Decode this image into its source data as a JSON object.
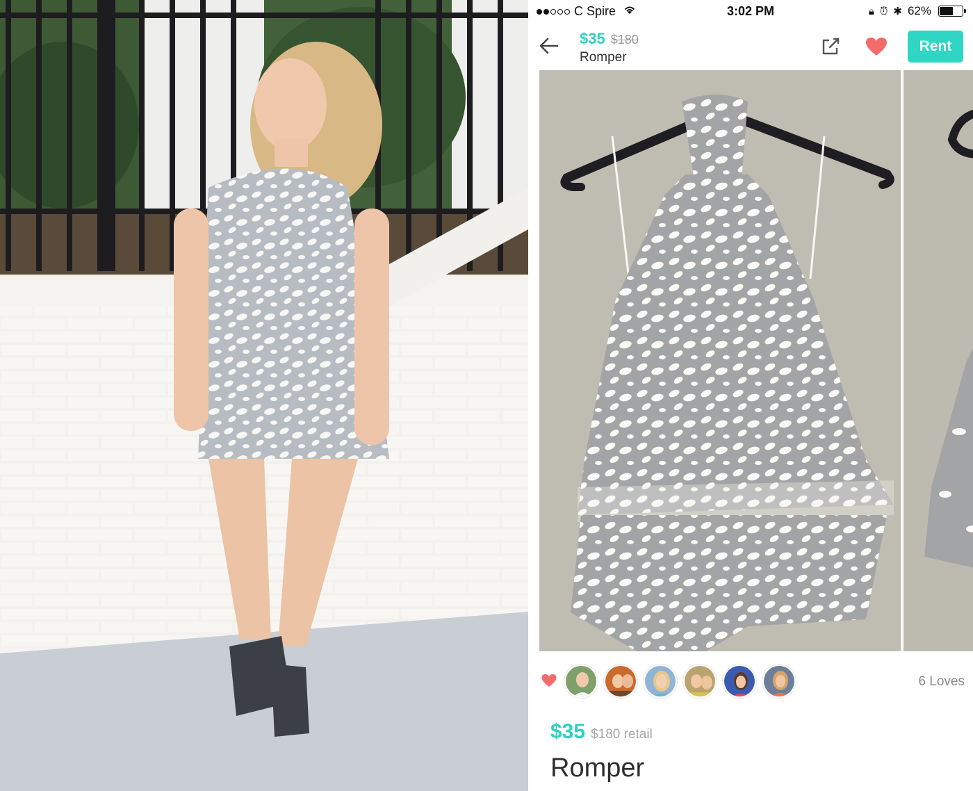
{
  "status_bar": {
    "signal_bars_filled": 2,
    "signal_bars_total": 5,
    "carrier": "C Spire",
    "time": "3:02 PM",
    "battery_percent_text": "62%",
    "battery_level": 0.62,
    "icons": [
      "wifi-icon",
      "orientation-lock-icon",
      "alarm-icon",
      "bluetooth-icon",
      "battery-icon"
    ]
  },
  "nav": {
    "price": "$35",
    "retail": "$180",
    "title": "Romper",
    "back_icon": "arrow-left-icon",
    "share_icon": "external-share-icon",
    "heart_icon": "heart-icon",
    "rent_label": "Rent"
  },
  "gallery": {
    "images": [
      "romper-on-hanger-photo",
      "romper-second-photo-partial"
    ]
  },
  "lifestyle_photo": "woman-wearing-romper-photo",
  "loves": {
    "heart_icon": "heart-icon",
    "avatars": [
      "avatar-1",
      "avatar-2",
      "avatar-3",
      "avatar-4",
      "avatar-5",
      "avatar-6"
    ],
    "count_label": "6 Loves"
  },
  "detail": {
    "price": "$35",
    "retail": "$180 retail",
    "title": "Romper"
  },
  "colors": {
    "accent": "#2fd6c4",
    "heart": "#f36b6b",
    "muted": "#9a9a9a"
  }
}
